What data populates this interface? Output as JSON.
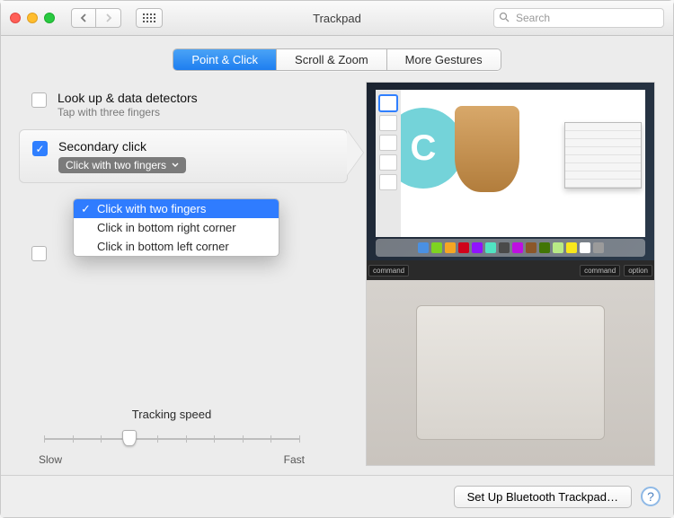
{
  "window": {
    "title": "Trackpad"
  },
  "search": {
    "placeholder": "Search"
  },
  "tabs": [
    {
      "label": "Point & Click",
      "active": true
    },
    {
      "label": "Scroll & Zoom",
      "active": false
    },
    {
      "label": "More Gestures",
      "active": false
    }
  ],
  "options": {
    "lookup": {
      "title": "Look up & data detectors",
      "subtitle": "Tap with three fingers",
      "checked": false
    },
    "secondary": {
      "title": "Secondary click",
      "button_label": "Click with two fingers",
      "checked": true
    },
    "third": {
      "checked": false
    }
  },
  "dropdown": {
    "items": [
      "Click with two fingers",
      "Click in bottom right corner",
      "Click in bottom left corner"
    ],
    "selected_index": 0
  },
  "tracking": {
    "label": "Tracking speed",
    "min_label": "Slow",
    "max_label": "Fast",
    "ticks": 10,
    "value_index": 3
  },
  "footer": {
    "button": "Set Up Bluetooth Trackpad…",
    "help": "?"
  },
  "preview": {
    "keys": [
      "command",
      "command",
      "option"
    ],
    "dock_colors": [
      "#4a90e2",
      "#7ed321",
      "#f5a623",
      "#d0021b",
      "#9013fe",
      "#50e3c2",
      "#4a4a4a",
      "#bd10e0",
      "#8b572a",
      "#417505",
      "#b8e986",
      "#f8e71c",
      "#ffffff",
      "#9b9b9b"
    ]
  }
}
